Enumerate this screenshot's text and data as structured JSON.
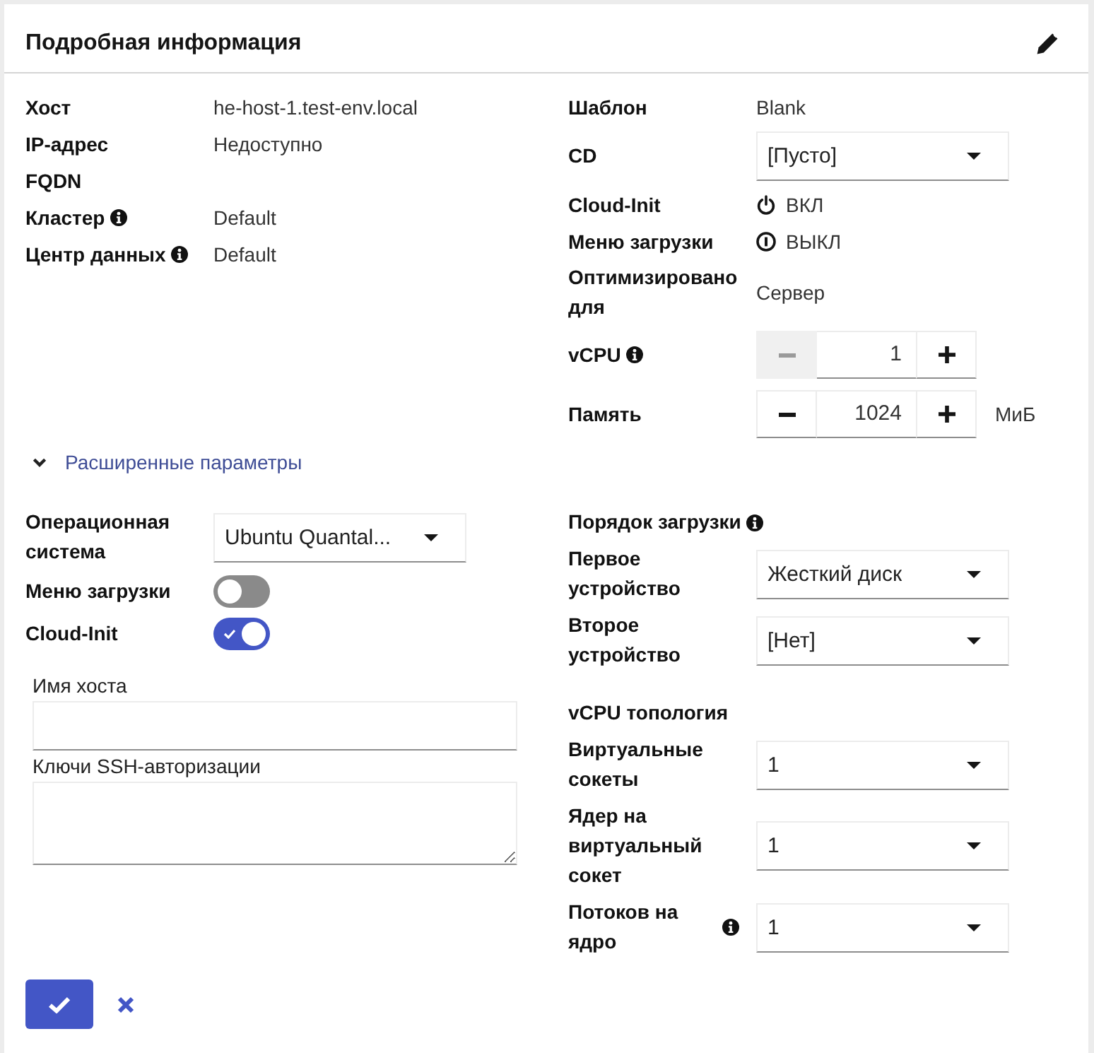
{
  "panel": {
    "title": "Подробная информация"
  },
  "general": [
    {
      "label": "Хост",
      "info": false,
      "value": "he-host-1.test-env.local"
    },
    {
      "label": "IP-адрес",
      "info": false,
      "value": "Недоступно"
    },
    {
      "label": "FQDN",
      "info": false
    },
    {
      "label": "Кластер",
      "info": true,
      "value": "Default"
    },
    {
      "label": "Центр данных",
      "info": true,
      "value": "Default"
    }
  ],
  "settings": [
    {
      "kind": "text",
      "label": "Шаблон",
      "info": false,
      "value": "Blank"
    },
    {
      "kind": "select",
      "label": "CD",
      "info": false,
      "value": "[Пусто]"
    },
    {
      "kind": "status",
      "label": "Cloud-Init",
      "info": false,
      "on": true,
      "value": "ВКЛ"
    },
    {
      "kind": "status",
      "label": "Меню загрузки",
      "info": false,
      "on": false,
      "value": "ВЫКЛ"
    },
    {
      "kind": "text",
      "label": "Оптимизировано для",
      "info": false,
      "value": "Сервер"
    },
    {
      "kind": "spinner",
      "label": "vCPU",
      "info": true,
      "value": "1",
      "decrement_disabled": true
    },
    {
      "kind": "spinner",
      "label": "Память",
      "info": false,
      "value": "1024",
      "decrement_disabled": false,
      "unit": "МиБ"
    }
  ],
  "advanced": {
    "label": "Расширенные параметры",
    "expanded": true
  },
  "os_settings": [
    {
      "kind": "select",
      "label": "Операционная система",
      "value": "Ubuntu Quantal..."
    },
    {
      "kind": "toggle",
      "label": "Меню загрузки",
      "on": false
    },
    {
      "kind": "toggle",
      "label": "Cloud-Init",
      "on": true
    }
  ],
  "cloud_init_fields": [
    {
      "kind": "input",
      "label": "Имя хоста"
    },
    {
      "kind": "textarea",
      "label": "Ключи SSH-авторизации"
    }
  ],
  "boot_order": {
    "title": "Порядок загрузки",
    "info": true,
    "devices": [
      {
        "label": "Первое устройство",
        "value": "Жесткий диск"
      },
      {
        "label": "Второе устройство",
        "value": "[Нет]"
      }
    ]
  },
  "vcpu_topology": {
    "title": "vCPU топология",
    "fields": [
      {
        "label": "Виртуальные сокеты",
        "info": false,
        "value": "1"
      },
      {
        "label": "Ядер на виртуальный сокет",
        "info": false,
        "value": "1"
      },
      {
        "label": "Потоков на ядро",
        "info": true,
        "value": "1"
      }
    ]
  }
}
